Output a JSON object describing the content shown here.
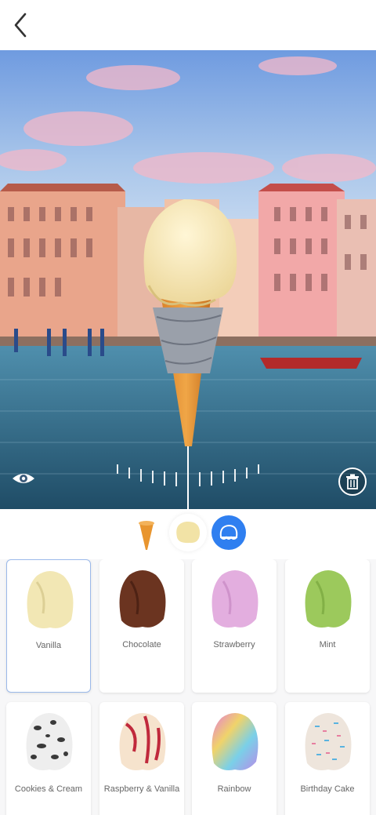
{
  "header": {
    "back_icon": "chevron-left-icon"
  },
  "scene": {
    "eye_icon": "eye-icon",
    "trash_icon": "trash-icon"
  },
  "steps": [
    {
      "name": "cone",
      "icon": "cone-icon"
    },
    {
      "name": "scoop",
      "icon": "scoop-icon",
      "selected": true
    },
    {
      "name": "toppings",
      "icon": "toppings-icon",
      "color": "#2f7ff0"
    }
  ],
  "flavors": [
    {
      "label": "Vanilla",
      "color": "#f2e7b4",
      "selected": true
    },
    {
      "label": "Chocolate",
      "color": "#6b3420"
    },
    {
      "label": "Strawberry",
      "color": "#e3aedf"
    },
    {
      "label": "Mint",
      "color": "#9cc95c"
    },
    {
      "label": "Cookies & Cream",
      "color": "#eeeeee"
    },
    {
      "label": "Raspberry & Vanilla",
      "color": "#f6e3cd"
    },
    {
      "label": "Rainbow",
      "color": "#e7a2e6"
    },
    {
      "label": "Birthday Cake",
      "color": "#eee5dc"
    }
  ]
}
